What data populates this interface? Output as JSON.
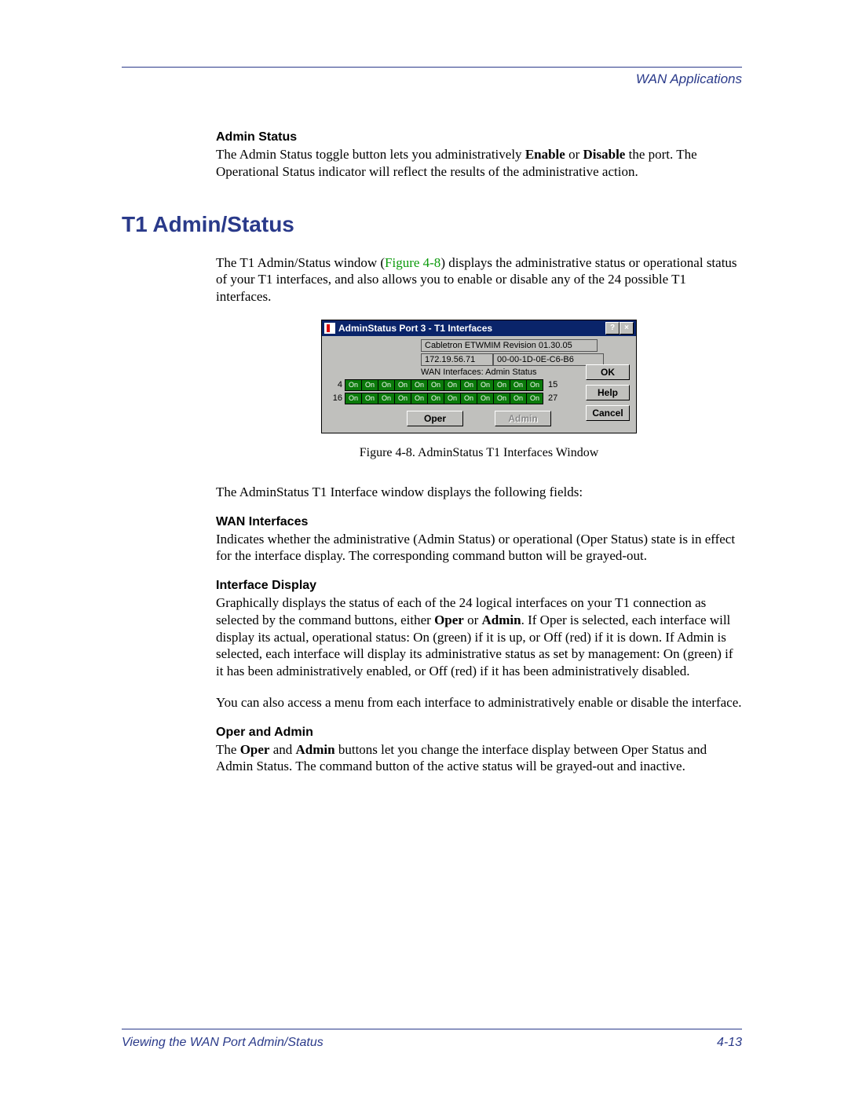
{
  "header": {
    "section": "WAN Applications"
  },
  "admin_status": {
    "heading": "Admin Status",
    "text_pre": "The Admin Status toggle button lets you administratively ",
    "bold1": "Enable",
    "mid": " or ",
    "bold2": "Disable",
    "text_post": " the port. The Operational Status indicator will reflect the results of the administrative action."
  },
  "h1": "T1 Admin/Status",
  "intro": {
    "pre": "The T1 Admin/Status window (",
    "figref": "Figure 4-8",
    "post": ") displays the administrative status or operational status of your T1 interfaces, and also allows you to enable or disable any of the 24 possible T1 interfaces."
  },
  "dialog": {
    "title": "AdminStatus Port 3 - T1 Interfaces",
    "help_glyph": "?",
    "close_glyph": "×",
    "device": "Cabletron ETWMIM Revision 01.30.05",
    "ip": "172.19.56.71",
    "mac": "00-00-1D-0E-C6-B6",
    "wan_label": "WAN Interfaces: Admin Status",
    "ok": "OK",
    "help": "Help",
    "cancel": "Cancel",
    "row1_left": "4",
    "row1_right": "15",
    "row2_left": "16",
    "row2_right": "27",
    "cell_label": "On",
    "oper": "Oper",
    "admin": "Admin"
  },
  "caption": "Figure 4-8. AdminStatus T1 Interfaces Window",
  "para_after_fig": "The AdminStatus T1 Interface window displays the following fields:",
  "wan_if": {
    "heading": "WAN Interfaces",
    "text": "Indicates whether the administrative (Admin Status) or operational (Oper Status) state is in effect for the interface display. The corresponding command button will be grayed-out."
  },
  "if_disp": {
    "heading": "Interface Display",
    "p1_pre": "Graphically displays the status of each of the 24 logical interfaces on your T1 connection as selected by the command buttons, either ",
    "b1": "Oper",
    "mid1": " or ",
    "b2": "Admin",
    "p1_post": ". If Oper is selected, each interface will display its actual, operational status: On (green) if it is up, or Off (red) if it is down. If Admin is selected, each interface will display its administrative status as set by management: On (green) if it has been administratively enabled, or Off (red) if it has been administratively disabled.",
    "p2": "You can also access a menu from each interface to administratively enable or disable the interface."
  },
  "oper_admin": {
    "heading": "Oper and Admin",
    "pre": "The ",
    "b1": "Oper",
    "mid": " and ",
    "b2": "Admin",
    "post": " buttons let you change the interface display between Oper Status and Admin Status. The command button of the active status will be grayed-out and inactive."
  },
  "footer": {
    "left": "Viewing the WAN Port Admin/Status",
    "right": "4-13"
  }
}
